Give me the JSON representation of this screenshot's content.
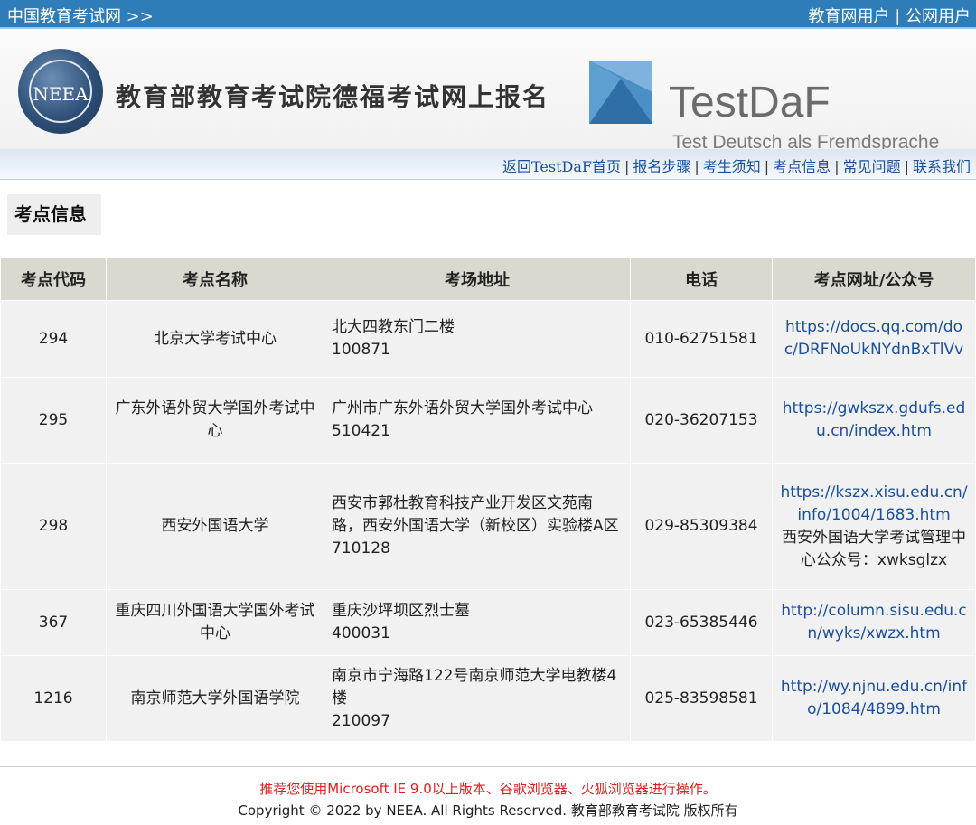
{
  "topbar": {
    "site_link": "中国教育考试网 >>",
    "user_educational": "教育网用户",
    "separator": "|",
    "user_public": "公网用户"
  },
  "header": {
    "logo_text": "NEEA",
    "title": "教育部教育考试院德福考试网上报名",
    "testdaf_title": "TestDaF",
    "testdaf_subtitle": "Test Deutsch als Fremdsprache",
    "brand_color": "#2f7db8"
  },
  "nav": {
    "items": [
      {
        "label": "返回TestDaF首页"
      },
      {
        "label": "报名步骤"
      },
      {
        "label": "考生须知"
      },
      {
        "label": "考点信息"
      },
      {
        "label": "常见问题"
      },
      {
        "label": "联系我们"
      }
    ],
    "separator": "|"
  },
  "section": {
    "title": "考点信息"
  },
  "table": {
    "headers": [
      "考点代码",
      "考点名称",
      "考场地址",
      "电话",
      "考点网址/公众号"
    ],
    "rows": [
      {
        "code": "294",
        "name": "北京大学考试中心",
        "address": [
          "北大四教东门二楼",
          "100871"
        ],
        "phone": "010-62751581",
        "web": [
          "https://docs.qq.com/doc/DRFNoUkNYdnBxTlVv"
        ]
      },
      {
        "code": "295",
        "name": "广东外语外贸大学国外考试中心",
        "address": [
          "广州市广东外语外贸大学国外考试中心",
          "510421"
        ],
        "phone": "020-36207153",
        "web": [
          "https://gwkszx.gdufs.edu.cn/index.htm"
        ]
      },
      {
        "code": "298",
        "name": "西安外国语大学",
        "address": [
          "西安市郭杜教育科技产业开发区文苑南路，西安外国语大学（新校区）实验楼A区",
          "710128"
        ],
        "phone": "029-85309384",
        "web": [
          "https://kszx.xisu.edu.cn/info/1004/1683.htm"
        ],
        "web_note": "西安外国语大学考试管理中心公众号：xwksglzx"
      },
      {
        "code": "367",
        "name": "重庆四川外国语大学国外考试中心",
        "address": [
          "重庆沙坪坝区烈士墓",
          "400031"
        ],
        "phone": "023-65385446",
        "web": [
          "http://column.sisu.edu.cn/wyks/xwzx.htm"
        ]
      },
      {
        "code": "1216",
        "name": "南京师范大学外国语学院",
        "address": [
          "南京市宁海路122号南京师范大学电教楼4楼",
          "210097"
        ],
        "phone": "025-83598581",
        "web": [
          "http://wy.njnu.edu.cn/info/1084/4899.htm"
        ]
      }
    ]
  },
  "footer": {
    "notice": "推荐您使用Microsoft IE 9.0以上版本、谷歌浏览器、火狐浏览器进行操作。",
    "copyright": "Copyright © 2022 by NEEA. All Rights Reserved. 教育部教育考试院 版权所有",
    "notice_color": "#e02020"
  }
}
